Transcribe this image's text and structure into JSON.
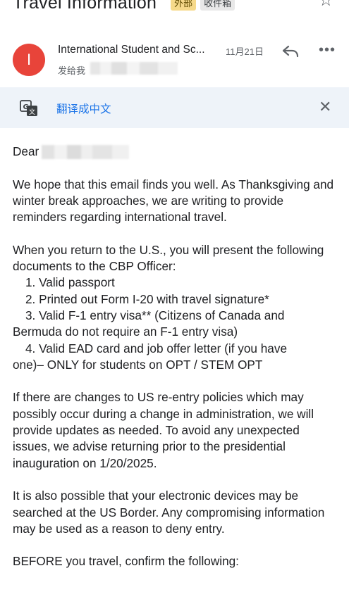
{
  "header": {
    "subject": "Travel Information",
    "labels": [
      "外部",
      "收件箱"
    ]
  },
  "sender": {
    "avatar_letter": "I",
    "name": "International Student and Sc...",
    "date": "11月21日",
    "sent_to": "发给我"
  },
  "translate_bar": {
    "link": "翻译成中文"
  },
  "body": {
    "greeting": "Dear",
    "p1": "We hope that this email finds you well.  As Thanksgiving and winter break approaches, we are writing to provide reminders regarding international travel.",
    "p2_intro": "When you return to the U.S., you will present the following documents to the CBP Officer:",
    "list": [
      "1. Valid passport",
      "2. Printed out Form I-20 with travel signature*",
      "3. Valid F-1 entry visa** (Citizens of Canada and"
    ],
    "list_3_cont": "Bermuda do not require an F-1 entry visa)",
    "list_4": "4. Valid EAD card and job offer letter (if you have",
    "list_4_cont": "one)– ONLY for students on OPT / STEM OPT",
    "p3": "If there are changes to US re-entry policies which may possibly occur during a change in administration, we will provide updates as needed. To avoid any unexpected issues, we advise returning prior to the presidential inauguration on 1/20/2025.",
    "p4": "It is also possible that your electronic devices may be searched at the US Border. Any compromising information may be used as a reason to deny entry.",
    "p5": "BEFORE you travel, confirm the following:"
  },
  "colors": {
    "avatar_bg": "#e8443a",
    "translate_bar_bg": "#eef3f9",
    "link": "#1a73e8",
    "external_chip": "#f6d98a"
  },
  "icons": [
    "star-icon",
    "reply-icon",
    "more-icon",
    "translate-icon",
    "close-icon"
  ]
}
